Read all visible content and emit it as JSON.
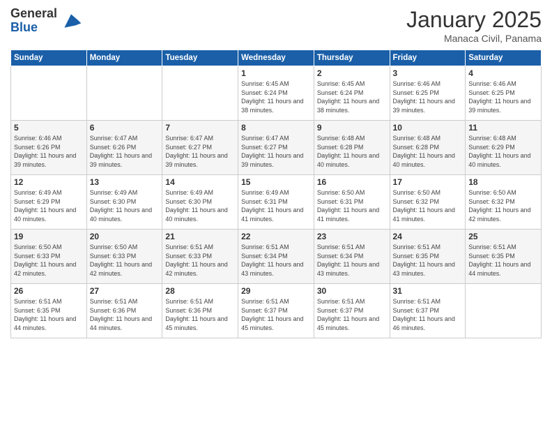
{
  "header": {
    "logo_general": "General",
    "logo_blue": "Blue",
    "month_title": "January 2025",
    "subtitle": "Manaca Civil, Panama"
  },
  "days_of_week": [
    "Sunday",
    "Monday",
    "Tuesday",
    "Wednesday",
    "Thursday",
    "Friday",
    "Saturday"
  ],
  "weeks": [
    [
      {
        "day": "",
        "info": ""
      },
      {
        "day": "",
        "info": ""
      },
      {
        "day": "",
        "info": ""
      },
      {
        "day": "1",
        "info": "Sunrise: 6:45 AM\nSunset: 6:24 PM\nDaylight: 11 hours and 38 minutes."
      },
      {
        "day": "2",
        "info": "Sunrise: 6:45 AM\nSunset: 6:24 PM\nDaylight: 11 hours and 38 minutes."
      },
      {
        "day": "3",
        "info": "Sunrise: 6:46 AM\nSunset: 6:25 PM\nDaylight: 11 hours and 39 minutes."
      },
      {
        "day": "4",
        "info": "Sunrise: 6:46 AM\nSunset: 6:25 PM\nDaylight: 11 hours and 39 minutes."
      }
    ],
    [
      {
        "day": "5",
        "info": "Sunrise: 6:46 AM\nSunset: 6:26 PM\nDaylight: 11 hours and 39 minutes."
      },
      {
        "day": "6",
        "info": "Sunrise: 6:47 AM\nSunset: 6:26 PM\nDaylight: 11 hours and 39 minutes."
      },
      {
        "day": "7",
        "info": "Sunrise: 6:47 AM\nSunset: 6:27 PM\nDaylight: 11 hours and 39 minutes."
      },
      {
        "day": "8",
        "info": "Sunrise: 6:47 AM\nSunset: 6:27 PM\nDaylight: 11 hours and 39 minutes."
      },
      {
        "day": "9",
        "info": "Sunrise: 6:48 AM\nSunset: 6:28 PM\nDaylight: 11 hours and 40 minutes."
      },
      {
        "day": "10",
        "info": "Sunrise: 6:48 AM\nSunset: 6:28 PM\nDaylight: 11 hours and 40 minutes."
      },
      {
        "day": "11",
        "info": "Sunrise: 6:48 AM\nSunset: 6:29 PM\nDaylight: 11 hours and 40 minutes."
      }
    ],
    [
      {
        "day": "12",
        "info": "Sunrise: 6:49 AM\nSunset: 6:29 PM\nDaylight: 11 hours and 40 minutes."
      },
      {
        "day": "13",
        "info": "Sunrise: 6:49 AM\nSunset: 6:30 PM\nDaylight: 11 hours and 40 minutes."
      },
      {
        "day": "14",
        "info": "Sunrise: 6:49 AM\nSunset: 6:30 PM\nDaylight: 11 hours and 40 minutes."
      },
      {
        "day": "15",
        "info": "Sunrise: 6:49 AM\nSunset: 6:31 PM\nDaylight: 11 hours and 41 minutes."
      },
      {
        "day": "16",
        "info": "Sunrise: 6:50 AM\nSunset: 6:31 PM\nDaylight: 11 hours and 41 minutes."
      },
      {
        "day": "17",
        "info": "Sunrise: 6:50 AM\nSunset: 6:32 PM\nDaylight: 11 hours and 41 minutes."
      },
      {
        "day": "18",
        "info": "Sunrise: 6:50 AM\nSunset: 6:32 PM\nDaylight: 11 hours and 42 minutes."
      }
    ],
    [
      {
        "day": "19",
        "info": "Sunrise: 6:50 AM\nSunset: 6:33 PM\nDaylight: 11 hours and 42 minutes."
      },
      {
        "day": "20",
        "info": "Sunrise: 6:50 AM\nSunset: 6:33 PM\nDaylight: 11 hours and 42 minutes."
      },
      {
        "day": "21",
        "info": "Sunrise: 6:51 AM\nSunset: 6:33 PM\nDaylight: 11 hours and 42 minutes."
      },
      {
        "day": "22",
        "info": "Sunrise: 6:51 AM\nSunset: 6:34 PM\nDaylight: 11 hours and 43 minutes."
      },
      {
        "day": "23",
        "info": "Sunrise: 6:51 AM\nSunset: 6:34 PM\nDaylight: 11 hours and 43 minutes."
      },
      {
        "day": "24",
        "info": "Sunrise: 6:51 AM\nSunset: 6:35 PM\nDaylight: 11 hours and 43 minutes."
      },
      {
        "day": "25",
        "info": "Sunrise: 6:51 AM\nSunset: 6:35 PM\nDaylight: 11 hours and 44 minutes."
      }
    ],
    [
      {
        "day": "26",
        "info": "Sunrise: 6:51 AM\nSunset: 6:35 PM\nDaylight: 11 hours and 44 minutes."
      },
      {
        "day": "27",
        "info": "Sunrise: 6:51 AM\nSunset: 6:36 PM\nDaylight: 11 hours and 44 minutes."
      },
      {
        "day": "28",
        "info": "Sunrise: 6:51 AM\nSunset: 6:36 PM\nDaylight: 11 hours and 45 minutes."
      },
      {
        "day": "29",
        "info": "Sunrise: 6:51 AM\nSunset: 6:37 PM\nDaylight: 11 hours and 45 minutes."
      },
      {
        "day": "30",
        "info": "Sunrise: 6:51 AM\nSunset: 6:37 PM\nDaylight: 11 hours and 45 minutes."
      },
      {
        "day": "31",
        "info": "Sunrise: 6:51 AM\nSunset: 6:37 PM\nDaylight: 11 hours and 46 minutes."
      },
      {
        "day": "",
        "info": ""
      }
    ]
  ]
}
